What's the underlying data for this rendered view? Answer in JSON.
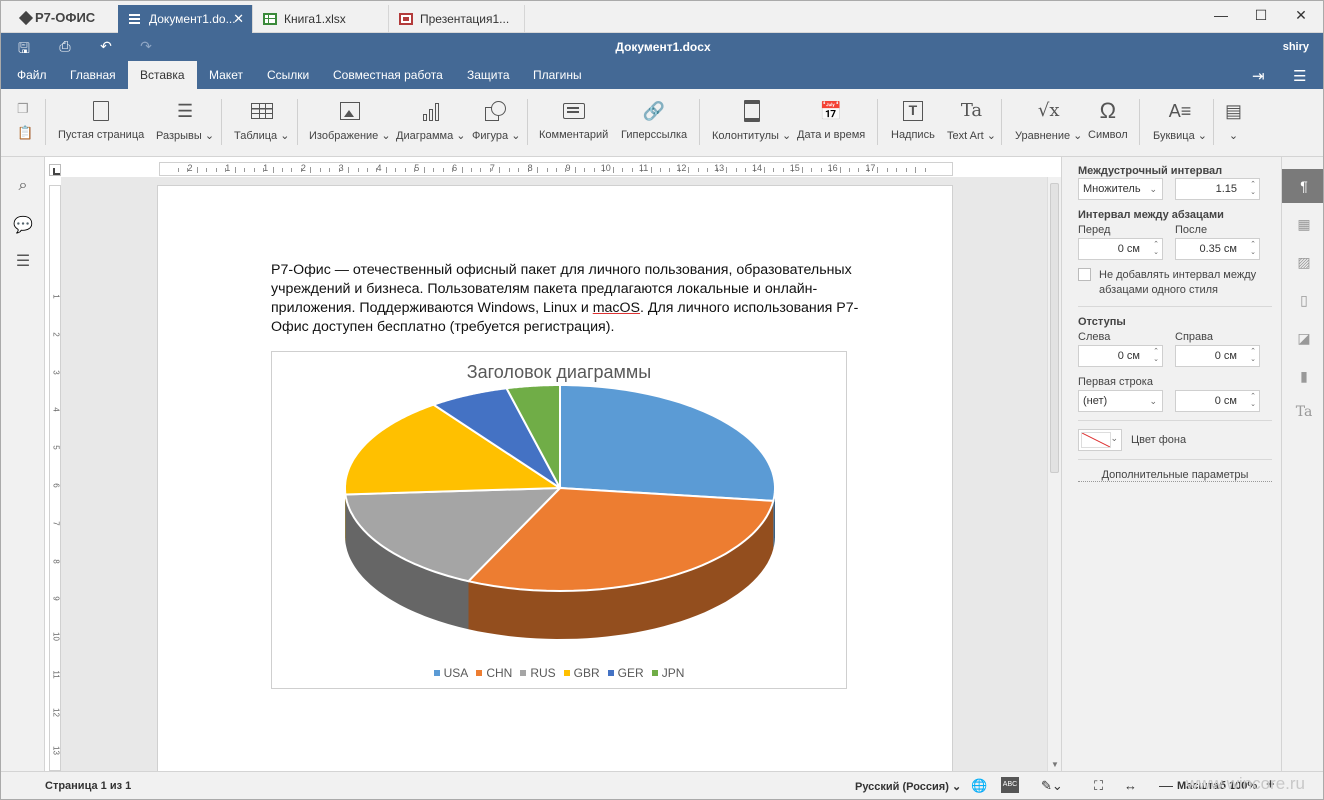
{
  "app": {
    "logo": "Р7-ОФИС"
  },
  "tabs": [
    {
      "label": "Документ1.do...",
      "active": true,
      "type": "doc"
    },
    {
      "label": "Книга1.xlsx",
      "active": false,
      "type": "xls"
    },
    {
      "label": "Презентация1...",
      "active": false,
      "type": "ppt"
    }
  ],
  "window": {
    "minimize": "—",
    "maximize": "☐",
    "close": "✕"
  },
  "titlebar": {
    "title": "Документ1.docx",
    "user": "shiry"
  },
  "menu": [
    "Файл",
    "Главная",
    "Вставка",
    "Макет",
    "Ссылки",
    "Совместная работа",
    "Защита",
    "Плагины"
  ],
  "menu_active": "Вставка",
  "toolbar": {
    "blank_page": "Пустая страница",
    "breaks": "Разрывы",
    "table": "Таблица",
    "image": "Изображение",
    "chart": "Диаграмма",
    "shape": "Фигура",
    "comment": "Комментарий",
    "hyperlink": "Гиперссылка",
    "header_footer": "Колонтитулы",
    "date_time": "Дата и время",
    "text_box": "Надпись",
    "text_art": "Text Art",
    "equation": "Уравнение",
    "symbol": "Символ",
    "drop_cap": "Буквица"
  },
  "ruler": {
    "h_numbers": [
      "2",
      "1",
      "1",
      "2",
      "3",
      "4",
      "5",
      "6",
      "7",
      "8",
      "9",
      "10",
      "11",
      "12",
      "13",
      "14",
      "15",
      "16",
      "17"
    ],
    "v_numbers": [
      "1",
      "2",
      "3",
      "4",
      "5",
      "6",
      "7",
      "8",
      "9",
      "10",
      "11",
      "12",
      "13"
    ]
  },
  "document": {
    "p1": "Р7-Офис — отечественный офисный пакет для личного пользования, образовательных учреждений и бизнеса. Пользователям пакета предлагаются локальные и онлайн-приложения. Поддерживаются Windows, Linux и ",
    "p1_underlined": "macOS",
    "p1_end": ". Для личного использования Р7-Офис доступен бесплатно (требуется регистрация)."
  },
  "chart_data": {
    "type": "pie",
    "title": "Заголовок диаграммы",
    "categories": [
      "USA",
      "CHN",
      "RUS",
      "GBR",
      "GER",
      "JPN"
    ],
    "values": [
      27,
      30,
      17,
      16,
      6,
      4
    ],
    "colors": [
      "#5b9bd5",
      "#ed7d31",
      "#a5a5a5",
      "#ffc000",
      "#4472c4",
      "#70ad47"
    ],
    "legend": "bottom"
  },
  "right_panel": {
    "line_spacing_title": "Междустрочный интервал",
    "line_spacing_mode": "Множитель",
    "line_spacing_value": "1.15",
    "para_spacing_title": "Интервал между абзацами",
    "before_label": "Перед",
    "after_label": "После",
    "before_value": "0 см",
    "after_value": "0.35 см",
    "no_spacing_same_style": "Не добавлять интервал между абзацами одного стиля",
    "indents_title": "Отступы",
    "left_label": "Слева",
    "right_label": "Справа",
    "left_value": "0 см",
    "right_value": "0 см",
    "first_line_label": "Первая строка",
    "first_line_mode": "(нет)",
    "first_line_value": "0 см",
    "bg_color_label": "Цвет фона",
    "advanced_link": "Дополнительные параметры"
  },
  "status": {
    "page": "Страница 1 из 1",
    "language": "Русский (Россия)",
    "zoom": "Масштаб 100%",
    "watermark": "www.wincore.ru"
  }
}
